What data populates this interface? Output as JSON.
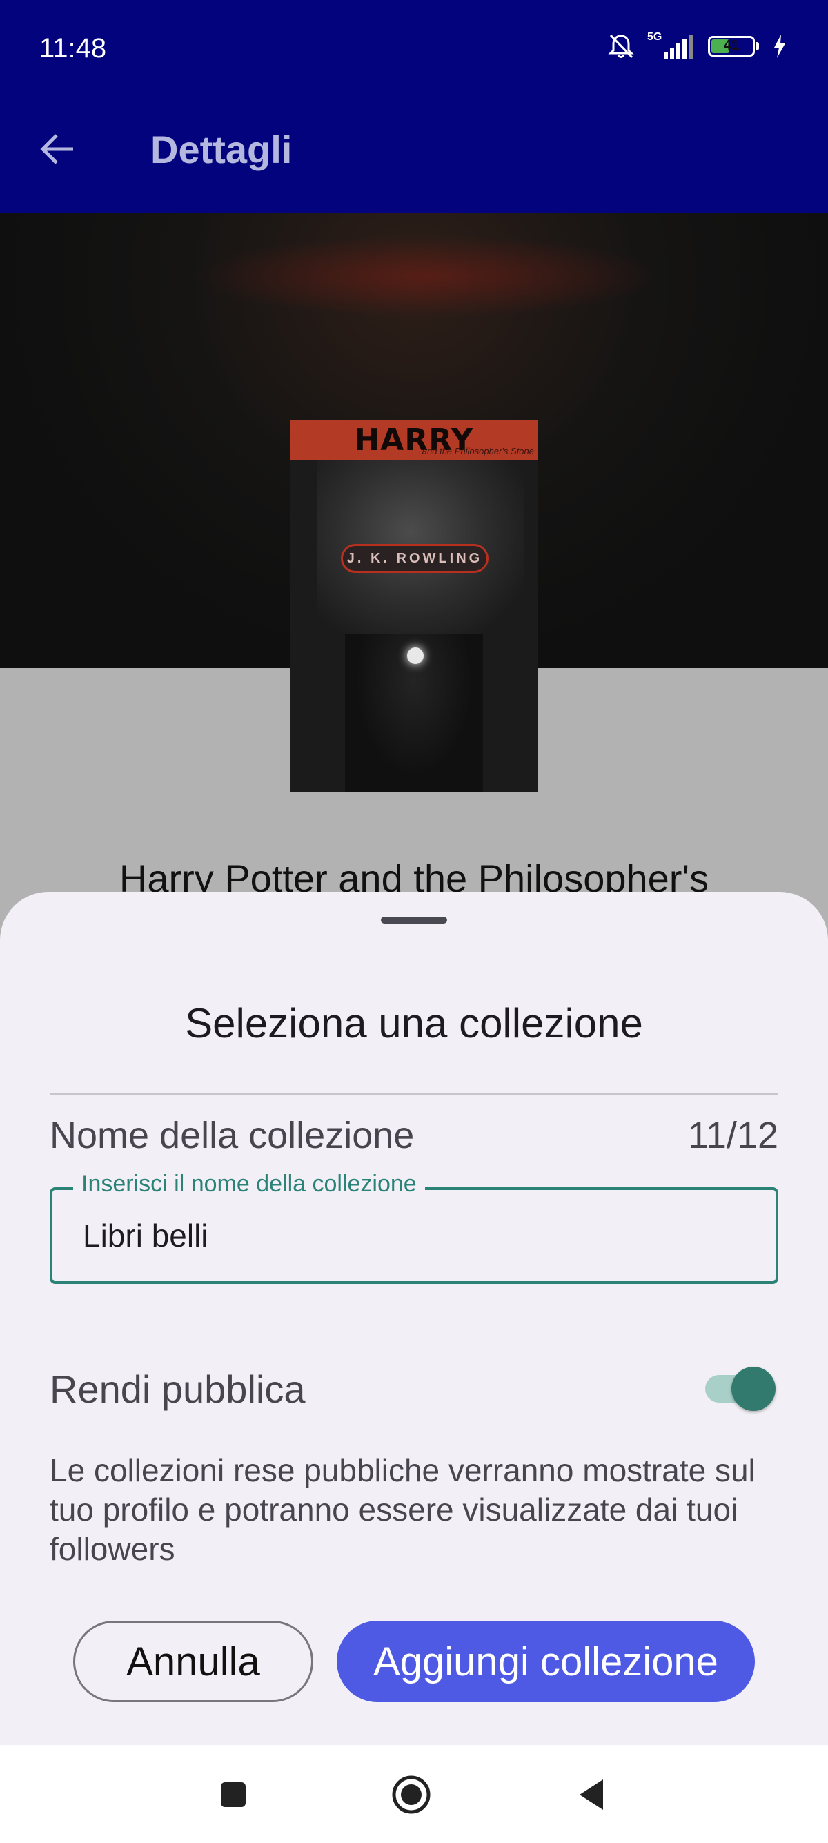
{
  "status_bar": {
    "time": "11:48",
    "network": "5G",
    "battery": "41"
  },
  "app_bar": {
    "title": "Dettagli"
  },
  "book": {
    "cover_title": "HARRY POTTER",
    "cover_subtitle": "and the Philosopher's Stone",
    "cover_author": "J. K. ROWLING",
    "title": "Harry Potter and the Philosopher's"
  },
  "sheet": {
    "title": "Seleziona una collezione",
    "field_label": "Nome della collezione",
    "counter": "11/12",
    "input_label": "Inserisci il nome della collezione",
    "input_value": "Libri belli",
    "public_label": "Rendi pubblica",
    "public_enabled": true,
    "help_text": "Le collezioni rese pubbliche verranno mostrate sul tuo profilo e potranno essere visualizzate dai tuoi followers",
    "cancel_label": "Annulla",
    "add_label": "Aggiungi collezione"
  },
  "colors": {
    "app_bar": "#03037e",
    "accent_teal": "#2b8377",
    "primary_button": "#4e5ae4"
  },
  "icons": {
    "back": "arrow-left-icon",
    "notifications_off": "bell-off-icon",
    "signal": "signal-icon",
    "battery": "battery-icon",
    "charging": "bolt-icon",
    "nav_recents": "square-icon",
    "nav_home": "circle-icon",
    "nav_back": "triangle-icon"
  }
}
